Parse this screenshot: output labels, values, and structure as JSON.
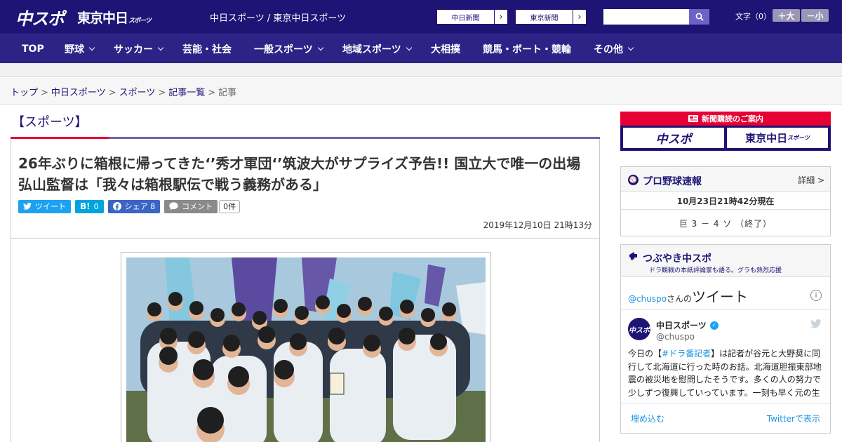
{
  "header": {
    "logo_chuspo": "中スポ",
    "logo_tokyo": "東京中日",
    "logo_tokyo_small": "スポーツ",
    "site_names": "中日スポーツ / 東京中日スポーツ",
    "ext_links": [
      "中日新聞",
      "東京新聞"
    ],
    "search_placeholder": "",
    "font_size_label": "文字（0）",
    "font_larger": "＋大",
    "font_smaller": "－小",
    "brand_color": "#1d1475"
  },
  "nav": {
    "items": [
      {
        "label": "TOP",
        "dropdown": false
      },
      {
        "label": "野球",
        "dropdown": true
      },
      {
        "label": "サッカー",
        "dropdown": true
      },
      {
        "label": "芸能・社会",
        "dropdown": false
      },
      {
        "label": "一般スポーツ",
        "dropdown": true
      },
      {
        "label": "地域スポーツ",
        "dropdown": true
      },
      {
        "label": "大相撲",
        "dropdown": false
      },
      {
        "label": "競馬・ボート・競輪",
        "dropdown": false
      },
      {
        "label": "その他",
        "dropdown": true
      }
    ]
  },
  "breadcrumb": {
    "links": [
      "トップ",
      "中日スポーツ",
      "スポーツ",
      "記事一覧"
    ],
    "current": "記事",
    "separator": ">"
  },
  "article": {
    "section": "【スポーツ】",
    "headline": "26年ぶりに箱根に帰ってきた‘’秀才軍団‘’筑波大がサプライズ予告!! 国立大で唯一の出場 弘山監督は「我々は箱根駅伝で戦う義務がある」",
    "share": {
      "tweet": "ツイート",
      "hatena_icon": "B!",
      "hatena_count": "0",
      "facebook": "シェア 8",
      "comment": "コメント",
      "comment_count": "0件"
    },
    "timestamp": "2019年12月10日 21時13分"
  },
  "sidebar": {
    "subscription": {
      "title": "新聞購読のご案内",
      "logo_left": "中スポ",
      "logo_right": "東京中日",
      "logo_right_small": "スポーツ"
    },
    "baseball": {
      "title": "プロ野球速報",
      "more": "詳細 >",
      "as_of": "10月23日21時42分現在",
      "game": "巨 3 － 4 ソ （終了）"
    },
    "tweets": {
      "title": "つぶやき中スポ",
      "subtitle": "ドラ観戦の本紙評論家も語る。グラも熱烈応援",
      "handle": "@chuspo",
      "handle_suffix": "さんの",
      "timeline_word": "ツイート",
      "account_name": "中日スポーツ",
      "screen_name": "@chuspo",
      "text_before": "今日の【",
      "hashtag": "#ドラ番記者",
      "text_after": "】は記者が谷元と大野奨に同行して北海道に行った時のお話。北海道胆振東部地震の被災地を慰問したそうです。多くの人の努力で少しずつ復興していっています。一刻も早く元の生活に",
      "embed": "埋め込む",
      "view_on_twitter": "Twitterで表示"
    }
  }
}
